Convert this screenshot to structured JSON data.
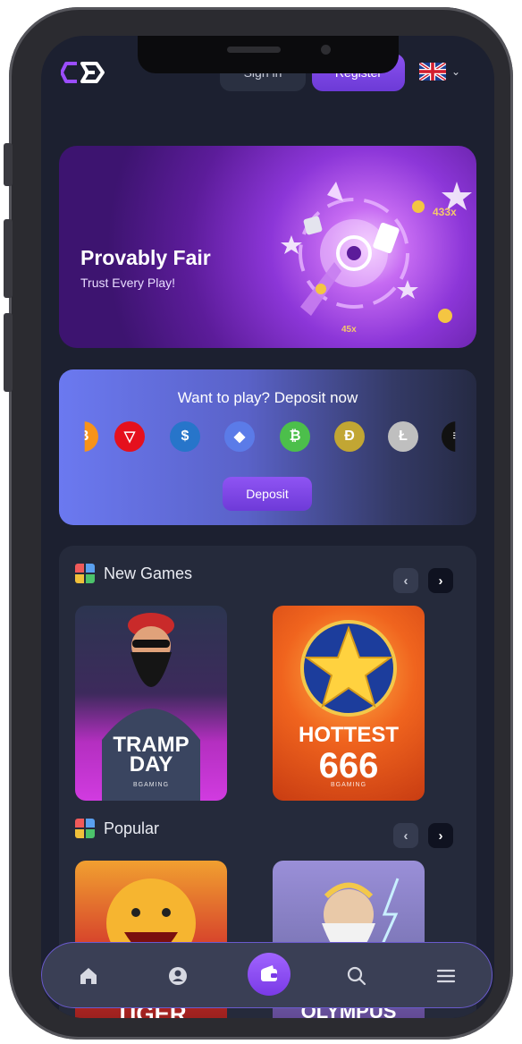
{
  "header": {
    "signin_label": "Sign in",
    "register_label": "Register",
    "language": "English"
  },
  "promo": {
    "title": "Provably Fair",
    "subtitle": "Trust Every Play!"
  },
  "deposit": {
    "title": "Want to play? Deposit now",
    "button_label": "Deposit",
    "coins": [
      {
        "name": "bitcoin",
        "color": "#f7931a",
        "glyph": "₿"
      },
      {
        "name": "tron",
        "color": "#e5101d",
        "glyph": "▽"
      },
      {
        "name": "usd-coin",
        "color": "#2775ca",
        "glyph": "$"
      },
      {
        "name": "ethereum",
        "color": "#5b7be8",
        "glyph": "◆"
      },
      {
        "name": "bitcoin-cash",
        "color": "#4cbf4b",
        "glyph": "₿"
      },
      {
        "name": "dogecoin",
        "color": "#c2a633",
        "glyph": "Ð"
      },
      {
        "name": "litecoin",
        "color": "#bfbfbf",
        "glyph": "Ł"
      },
      {
        "name": "other-coin",
        "color": "#111111",
        "glyph": "≡"
      }
    ]
  },
  "sections": [
    {
      "title": "New Games",
      "games": [
        {
          "title_line1": "TRAMP",
          "title_line2": "DAY",
          "studio": "BGAMING",
          "bg": "#3a2b58"
        },
        {
          "title_line1": "HOTTEST",
          "title_line2": "666",
          "studio": "BGAMING",
          "bg": "#e8631f"
        }
      ]
    },
    {
      "title": "Popular",
      "games": [
        {
          "title_line1": "TIGER",
          "title_line2": "",
          "studio": "",
          "bg": "#d2332b"
        },
        {
          "title_line1": "OLYMPUS",
          "title_line2": "",
          "studio": "",
          "bg": "#7d77b8"
        }
      ]
    }
  ],
  "bottom_nav": {
    "items": [
      "home-icon",
      "profile-icon",
      "wallet-icon",
      "search-icon",
      "menu-icon"
    ]
  },
  "colors": {
    "accent": "#7c3ff0",
    "background": "#1c2030",
    "panel": "#252a3b"
  }
}
